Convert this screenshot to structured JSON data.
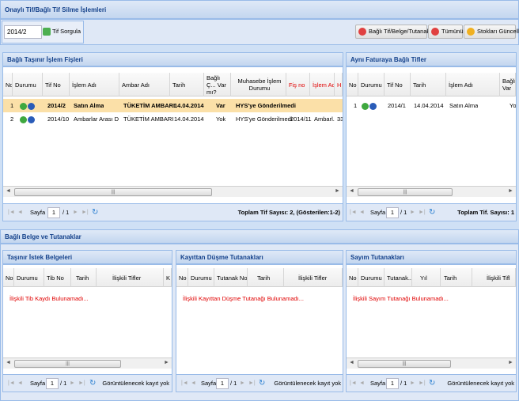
{
  "top": {
    "title": "Onaylı Tif/Bağlı Tif Silme İşlemleri",
    "tif_value": "2014/2",
    "query_button": "Tif Sorgula",
    "delete_linked_button": "Bağlı Tif/Belge/Tutanak Sil",
    "delete_all_button": "Tümünü Sil",
    "update_stocks_button": "Stokları Güncelle"
  },
  "transfer": {
    "title": "Bağlı Taşınır İşlem Fişleri",
    "columns": [
      "No",
      "Durumu",
      "Tif No",
      "İşlem Adı",
      "Ambar Adı",
      "Tarih",
      "Bağlı Ç... Var mı?",
      "Muhasebe İşlem Durumu",
      "Fiş no",
      "İşlem Adı",
      "H..."
    ],
    "rows": [
      {
        "no": "1",
        "tif": "2014/2",
        "islem": "Satın Alma",
        "ambar": "TÜKETİM AMBARI",
        "tarih": "14.04.2014",
        "bagli": "Var",
        "muh": "HYS'ye Gönderilmedi",
        "fis": "",
        "islem2": "",
        "h": ""
      },
      {
        "no": "2",
        "tif": "2014/10",
        "islem": "Ambarlar Arası D...",
        "ambar": "TÜKETİM AMBARI",
        "tarih": "14.04.2014",
        "bagli": "Yok",
        "muh": "HYS'ye Gönderilmedi",
        "fis": "2014/11",
        "islem2": "Ambarl...",
        "h": "33"
      }
    ],
    "pager": {
      "page_label": "Sayfa",
      "page": "1",
      "of": "/ 1",
      "total": "Toplam Tif Sayısı: 2, (Gösterilen:1-2)"
    }
  },
  "invoice": {
    "title": "Aynı Faturaya Bağlı Tifler",
    "columns": [
      "No",
      "Durumu",
      "Tif No",
      "Tarih",
      "İşlem Adı",
      "Bağlı Var"
    ],
    "rows": [
      {
        "no": "1",
        "tif": "2014/1",
        "tarih": "14.04.2014",
        "islem": "Satın Alma",
        "bagli": "Yo"
      }
    ],
    "pager": {
      "page_label": "Sayfa",
      "page": "1",
      "of": "/ 1",
      "total": "Toplam Tif. Sayısı: 1"
    }
  },
  "linked": {
    "title": "Bağlı Belge ve Tutanaklar",
    "request": {
      "title": "Taşınır İstek Belgeleri",
      "columns": [
        "No",
        "Durumu",
        "Tib No",
        "Tarih",
        "İlişkili Tifler",
        "K"
      ],
      "empty": "İlişkili Tib Kaydı Bulunamadı...",
      "pager": {
        "page_label": "Sayfa",
        "page": "1",
        "of": "/ 1",
        "total": "Görüntülenecek kayıt yok"
      }
    },
    "record": {
      "title": "Kayıttan Düşme Tutanakları",
      "columns": [
        "No",
        "Durumu",
        "Tutanak No",
        "Tarih",
        "İlişkili Tifler"
      ],
      "empty": "İlişkili Kayıttan Düşme Tutanağı Bulunamadı...",
      "pager": {
        "page_label": "Sayfa",
        "page": "1",
        "of": "/ 1",
        "total": "Görüntülenecek kayıt yok"
      }
    },
    "count": {
      "title": "Sayım Tutanakları",
      "columns": [
        "No",
        "Durumu",
        "Tutanak...",
        "Yıl",
        "Tarih",
        "İlişkili Tifl"
      ],
      "empty": "İlişkili Sayım Tutanağı Bulunamadı...",
      "pager": {
        "page_label": "Sayfa",
        "page": "1",
        "of": "/ 1",
        "total": "Görüntülenecek kayıt yok"
      }
    }
  },
  "icons": {
    "ok": "green-check-icon",
    "info": "blue-info-icon",
    "refresh": "refresh-icon"
  },
  "colors": {
    "header_text": "#15428b",
    "selected_row": "#fbe0a8",
    "empty_text": "#e00000"
  }
}
